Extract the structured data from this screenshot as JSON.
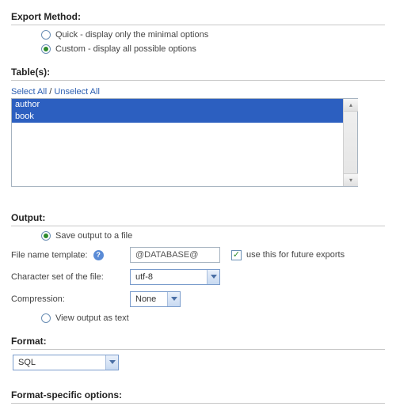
{
  "exportMethod": {
    "heading": "Export Method:",
    "quick": "Quick - display only the minimal options",
    "custom": "Custom - display all possible options",
    "selected": "custom"
  },
  "tables": {
    "heading": "Table(s):",
    "selectAll": "Select All",
    "unselectAll": "Unselect All",
    "separator": " / ",
    "items": [
      "author",
      "book"
    ]
  },
  "output": {
    "heading": "Output:",
    "saveLabel": "Save output to a file",
    "viewLabel": "View output as text",
    "selected": "save",
    "filenameTemplate": {
      "label": "File name template:",
      "value": "@DATABASE@",
      "futureLabel": "use this for future exports",
      "futureChecked": true
    },
    "charset": {
      "label": "Character set of the file:",
      "value": "utf-8"
    },
    "compression": {
      "label": "Compression:",
      "value": "None"
    }
  },
  "format": {
    "heading": "Format:",
    "value": "SQL"
  },
  "specific": {
    "heading": "Format-specific options:"
  }
}
